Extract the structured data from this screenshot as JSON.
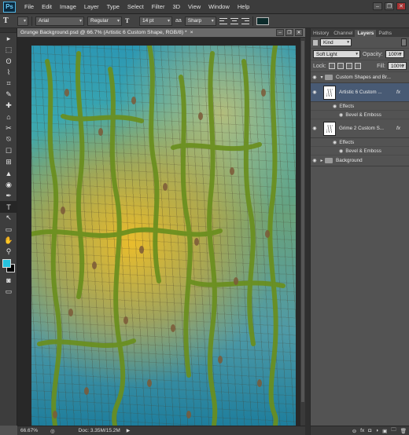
{
  "app": {
    "logo": "Ps"
  },
  "menu": [
    "File",
    "Edit",
    "Image",
    "Layer",
    "Type",
    "Select",
    "Filter",
    "3D",
    "View",
    "Window",
    "Help"
  ],
  "window_controls": [
    "–",
    "❐",
    "✕"
  ],
  "options": {
    "tool": "T",
    "font_family": "Arial",
    "font_style": "Regular",
    "size_icon": "T",
    "font_size": "14 pt",
    "aa_label": "aa",
    "antialias": "Sharp",
    "text_color": "#0c2b2b"
  },
  "tools": [
    "▸",
    "⬚",
    "ʘ",
    "⌇",
    "⌗",
    "✎",
    "✚",
    "⌂",
    "✂",
    "⍉",
    "☐",
    "⊞",
    "▲",
    "◉",
    "✒",
    "T",
    "↖",
    "▭",
    "✋",
    "⚲"
  ],
  "swatch": {
    "fg": "#26c3df",
    "bg": "#000000"
  },
  "document": {
    "tab_title": "Grunge Background.psd @ 66.7% (Artistic 6 Custom Shape, RGB/8) *",
    "close": "×",
    "zoom": "66.67%",
    "doc_size": "Doc: 3.35M/15.2M"
  },
  "panel": {
    "tabs": [
      "History",
      "Channel",
      "Layers",
      "Paths"
    ],
    "kind": "Kind",
    "blend_mode": "Soft Light",
    "opacity_label": "Opacity:",
    "opacity": "100%",
    "lock_label": "Lock:",
    "fill_label": "Fill:",
    "fill": "100%",
    "layers": [
      {
        "name": "Custom Shapes and Br...",
        "type": "group"
      },
      {
        "name": "Artistic 6 Custom ...",
        "fx": "fx",
        "effects": "Effects",
        "effect": "Bevel & Emboss",
        "selected": true
      },
      {
        "name": "Grime 2 Custom S...",
        "fx": "fx",
        "effects": "Effects",
        "effect": "Bevel & Emboss"
      },
      {
        "name": "Background",
        "type": "group"
      }
    ],
    "footer": [
      "⊖",
      "fx",
      "◘",
      "◑",
      "▣",
      "🗀",
      "🗑"
    ]
  }
}
